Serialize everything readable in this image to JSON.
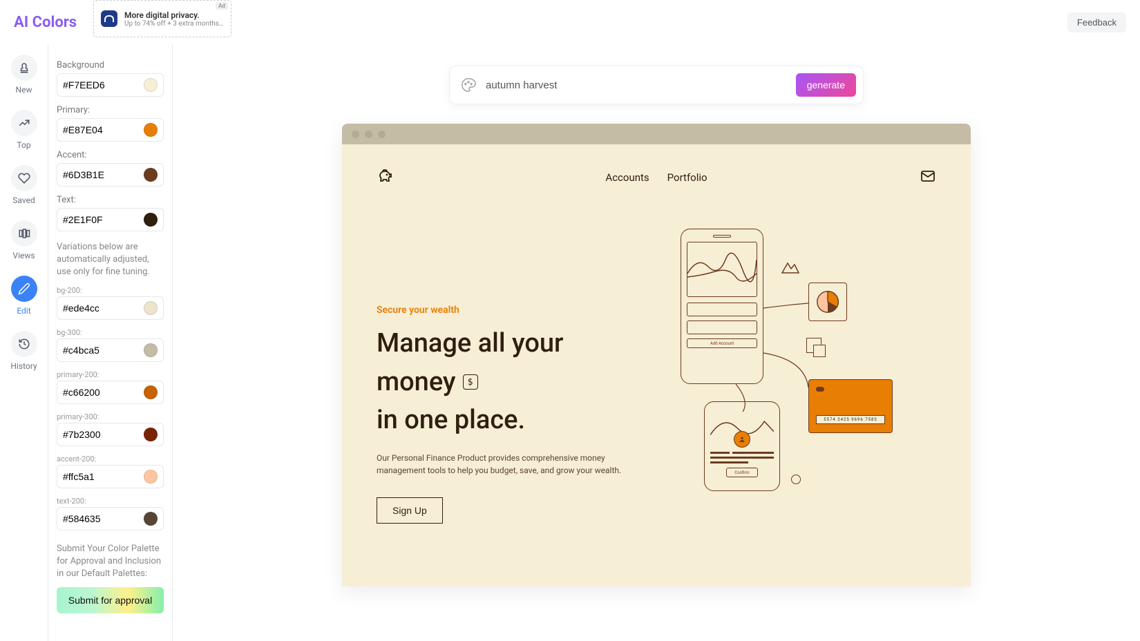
{
  "header": {
    "logo": "AI Colors",
    "feedback": "Feedback",
    "ad": {
      "badge": "Ad",
      "title": "More digital privacy.",
      "subtitle": "Up to 74% off + 3 extra months —"
    }
  },
  "nav": {
    "new": "New",
    "top": "Top",
    "saved": "Saved",
    "views": "Views",
    "edit": "Edit",
    "history": "History"
  },
  "panel": {
    "background_label": "Background",
    "background_value": "#F7EED6",
    "background_color": "#F7EED6",
    "primary_label": "Primary:",
    "primary_value": "#E87E04",
    "primary_color": "#E87E04",
    "accent_label": "Accent:",
    "accent_value": "#6D3B1E",
    "accent_color": "#6D3B1E",
    "text_label": "Text:",
    "text_value": "#2E1F0F",
    "text_color": "#2E1F0F",
    "variations_note": "Variations below are automatically adjusted, use only for fine tuning.",
    "bg200_label": "bg-200:",
    "bg200_value": "#ede4cc",
    "bg200_color": "#ede4cc",
    "bg300_label": "bg-300:",
    "bg300_value": "#c4bca5",
    "bg300_color": "#c4bca5",
    "primary200_label": "primary-200:",
    "primary200_value": "#c66200",
    "primary200_color": "#c66200",
    "primary300_label": "primary-300:",
    "primary300_value": "#7b2300",
    "primary300_color": "#7b2300",
    "accent200_label": "accent-200:",
    "accent200_value": "#ffc5a1",
    "accent200_color": "#ffc5a1",
    "text200_label": "text-200:",
    "text200_value": "#584635",
    "text200_color": "#584635",
    "submit_note": "Submit Your Color Palette for Approval and Inclusion in our Default Palettes:",
    "submit_button": "Submit for approval"
  },
  "prompt": {
    "value": "autumn harvest",
    "generate": "generate"
  },
  "preview": {
    "nav_accounts": "Accounts",
    "nav_portfolio": "Portfolio",
    "eyebrow": "Secure your wealth",
    "title_line1": "Manage all your",
    "title_line2a": "money",
    "title_line2b": "in one place.",
    "desc": "Our Personal Finance Product provides comprehensive money management tools to help you budget, save, and grow your wealth.",
    "signup": "Sign Up",
    "add_account": "Add Account",
    "card_number": "5574 2425 9696 7585",
    "confirm": "Confirm"
  }
}
